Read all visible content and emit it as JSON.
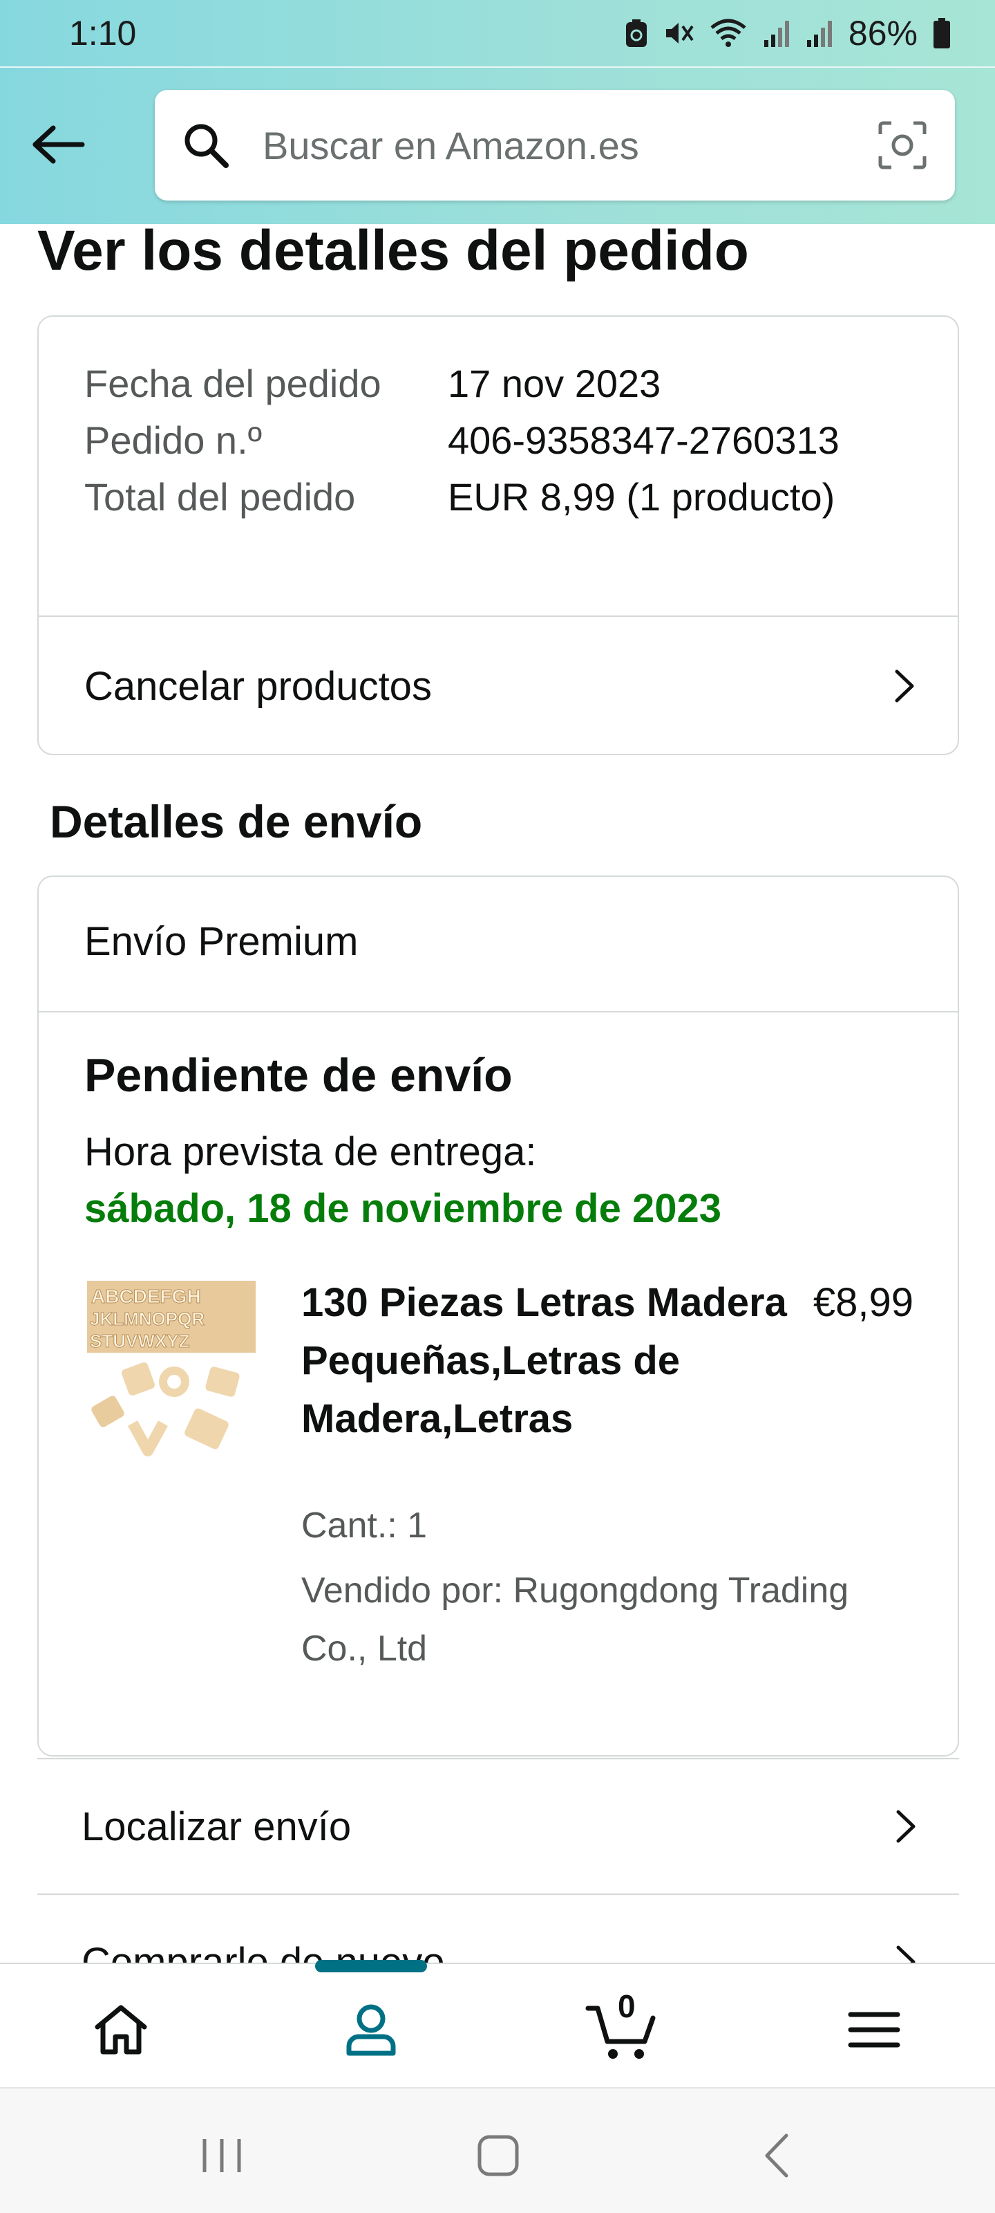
{
  "status_bar": {
    "time": "1:10",
    "battery": "86%"
  },
  "search": {
    "placeholder": "Buscar en Amazon.es"
  },
  "page": {
    "title": "Ver los detalles del pedido"
  },
  "order_summary": {
    "rows": [
      {
        "label": "Fecha del pedido",
        "value": "17 nov 2023"
      },
      {
        "label": "Pedido n.º",
        "value": "406-9358347-2760313"
      },
      {
        "label": "Total del pedido",
        "value": "EUR 8,99 (1 producto)"
      }
    ],
    "cancel_label": "Cancelar productos"
  },
  "shipping": {
    "section_title": "Detalles de envío",
    "type": "Envío Premium",
    "status": "Pendiente de envío",
    "delivery_label": "Hora prevista de entrega:",
    "delivery_date": "sábado, 18 de noviembre de 2023",
    "product": {
      "title": "130 Piezas Letras Madera Pequeñas,Letras de Madera,Letras",
      "price": "€8,99",
      "quantity": "Cant.: 1",
      "seller": "Vendido por: Rugongdong Trading Co., Ltd",
      "thumb_letters_row1": "ABCDEFGH",
      "thumb_letters_row2": "JKLMNOPQR",
      "thumb_letters_row3": "STUVWXYZ"
    }
  },
  "actions": {
    "track_label": "Localizar envío",
    "buy_again_label": "Comprarlo de nuevo"
  },
  "bottom_nav": {
    "items": [
      "home-icon",
      "account-icon",
      "cart-icon",
      "menu-icon"
    ],
    "cart_count": "0",
    "active_color": "#007185"
  },
  "colors": {
    "header_gradient_start": "#86d8df",
    "header_gradient_end": "#a7e5d6",
    "delivery_green": "#067d0b",
    "secondary_text": "#565959"
  }
}
